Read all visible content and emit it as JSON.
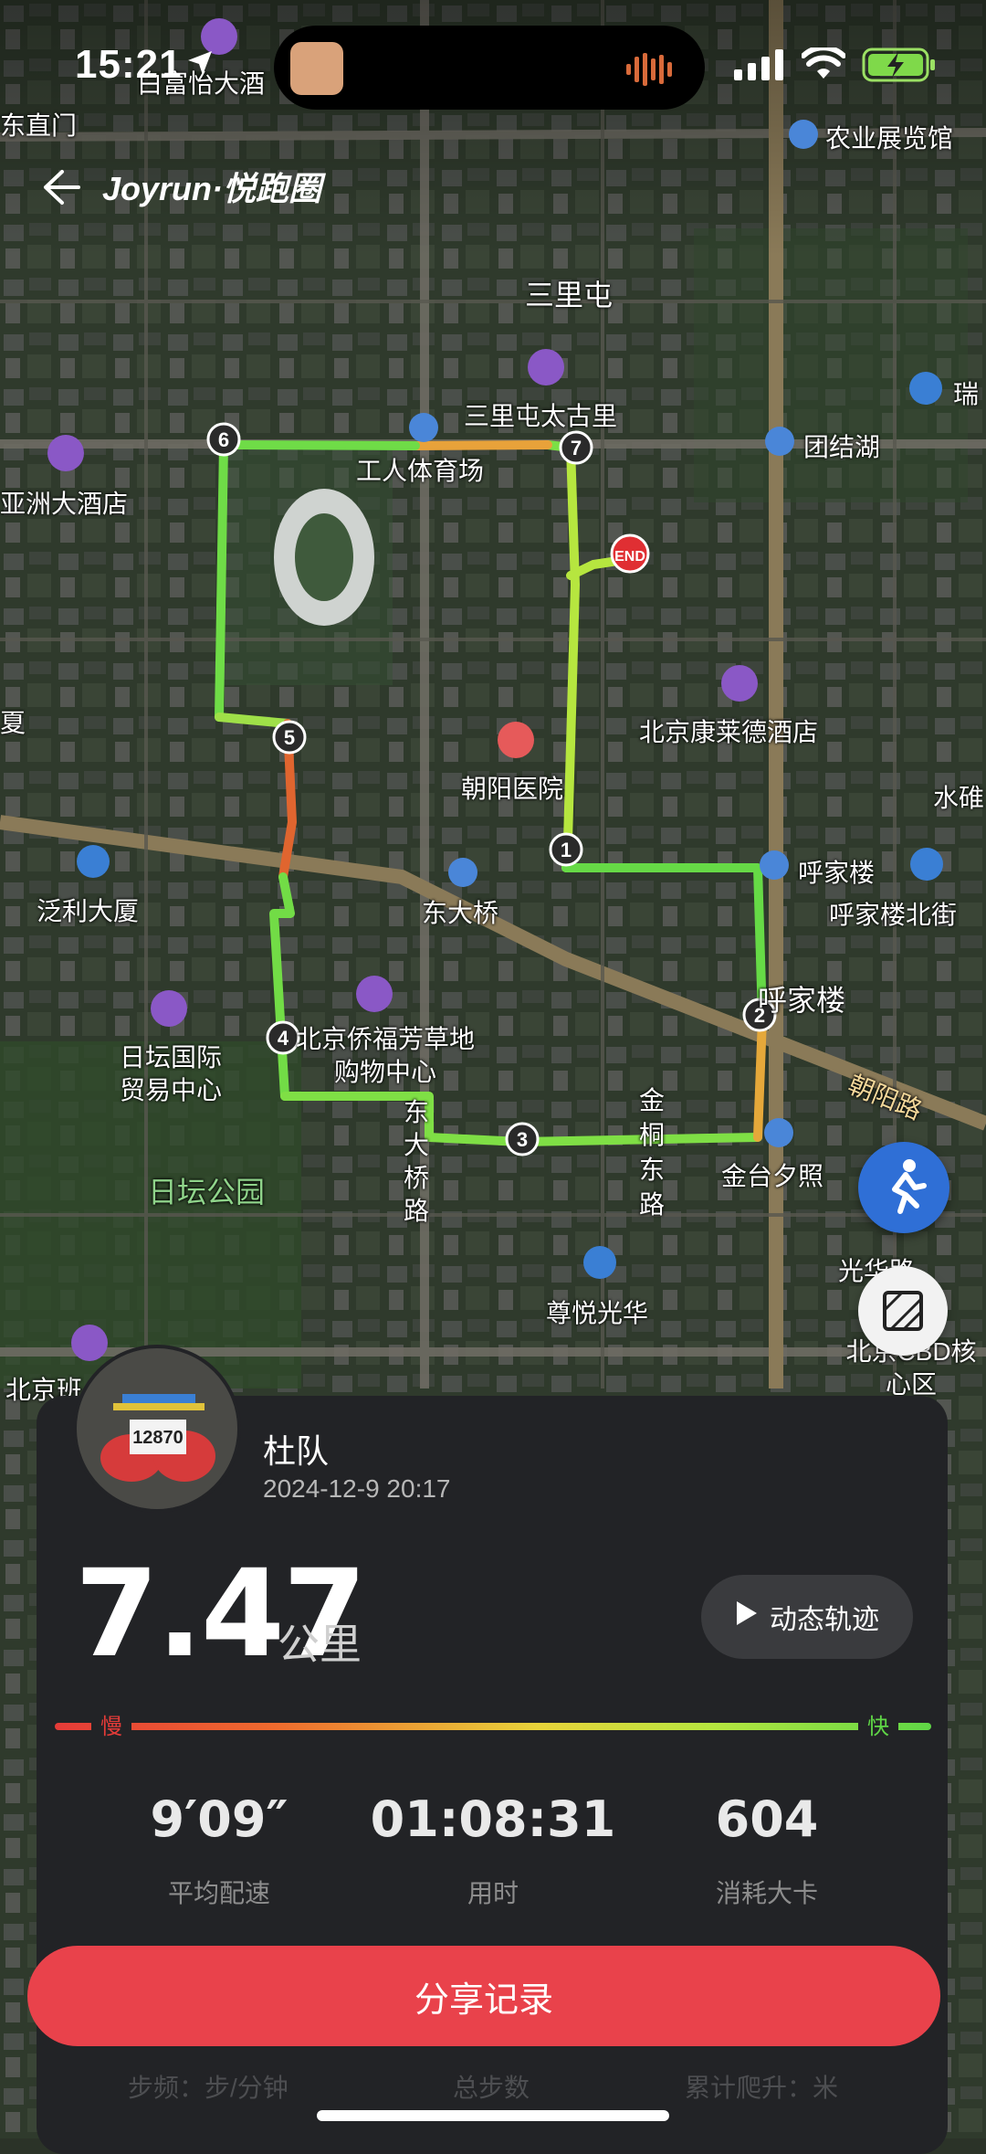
{
  "status_bar": {
    "time": "15:21"
  },
  "header": {
    "brand": "Joyrun·悦跑圈"
  },
  "map": {
    "labels": {
      "baifuyi": "白富怡大酒",
      "dongzhimen": "东直门",
      "nongzhan": "农业展览馆",
      "sanlitun": "三里屯",
      "taikooli": "三里屯太古里",
      "tuanjiehu": "团结湖",
      "rui": "瑞",
      "yazhou": "亚洲大酒店",
      "gongti": "工人体育场",
      "kempinski": "北京康莱德酒店",
      "chaoyang_hosp": "朝阳医院",
      "shui": "水碓",
      "fanli": "泛利大厦",
      "dongdaqiao": "东大桥",
      "hujialou": "呼家楼",
      "hujialou_north": "呼家楼北街",
      "hujialou2": "呼家楼",
      "chaoyang_rd": "朝阳路",
      "ritan_intl": "日坛国际贸易中心",
      "qiaofu": "北京侨福芳草地购物中心",
      "ritan_park": "日坛公园",
      "dongdaqiao_rd": "东大桥路",
      "jinhe_rd": "金桐东路",
      "jintai": "金台夕照",
      "guanghua_rd": "光华路",
      "zunyue": "尊悦光华",
      "cbd": "北京CBD核心区",
      "beijing_left": "北京班",
      "xia": "夏"
    },
    "markers": [
      "1",
      "2",
      "3",
      "4",
      "5",
      "6",
      "7"
    ],
    "end_label": "END"
  },
  "record": {
    "user_name": "杜队",
    "datetime": "2024-12-9 20:17",
    "distance": "7.47",
    "distance_unit": "公里",
    "replay_label": "动态轨迹",
    "slow_label": "慢",
    "fast_label": "快",
    "stats": [
      {
        "value": "9′09″",
        "label": "平均配速"
      },
      {
        "value": "01:08:31",
        "label": "用时"
      },
      {
        "value": "604",
        "label": "消耗大卡"
      }
    ],
    "share_label": "分享记录",
    "below_labels": [
      "步频：步/分钟",
      "总步数",
      "累计爬升：米"
    ]
  },
  "colors": {
    "accent": "#e9424b",
    "route_fast": "#5fd646",
    "route_slow": "#e53b38",
    "fab_blue": "#2f6fd6"
  }
}
